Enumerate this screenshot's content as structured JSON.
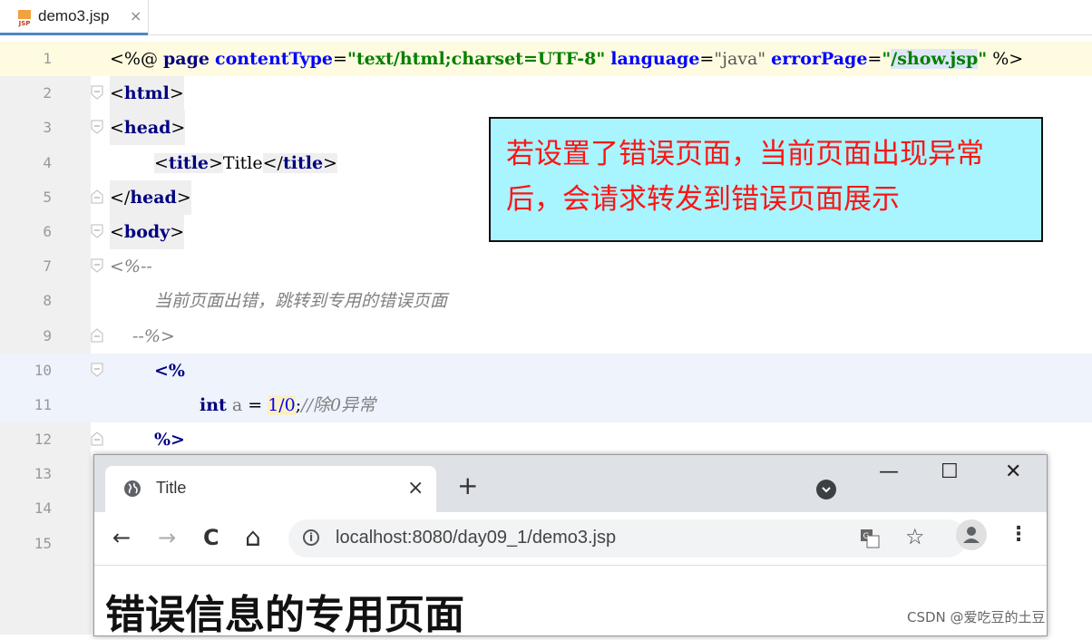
{
  "editor": {
    "tab": {
      "filename": "demo3.jsp",
      "close": "×"
    },
    "line_numbers": [
      "1",
      "2",
      "3",
      "4",
      "5",
      "6",
      "7",
      "8",
      "9",
      "10",
      "11",
      "12",
      "13",
      "14",
      "15"
    ],
    "code": {
      "l1": {
        "open": "<%@ ",
        "page": "page",
        "a1": "contentType",
        "eq1": "=",
        "v1": "\"text/html;charset=UTF-8\"",
        "a2": "language",
        "eq2": "=",
        "v2": "\"java\"",
        "a3": "errorPage",
        "eq3": "=",
        "v3q": "\"",
        "v3": "/show.jsp",
        "v3e": "\"",
        "close": " %>"
      },
      "l2": {
        "lt": "<",
        "tag": "html",
        "gt": ">"
      },
      "l3": {
        "lt": "<",
        "tag": "head",
        "gt": ">"
      },
      "l4": {
        "lt": "<",
        "tag": "title",
        "gt": ">",
        "text": "Title",
        "lt2": "</",
        "tag2": "title",
        "gt2": ">"
      },
      "l5": {
        "lt": "</",
        "tag": "head",
        "gt": ">"
      },
      "l6": {
        "lt": "<",
        "tag": "body",
        "gt": ">"
      },
      "l7": "<%--",
      "l8": "当前页面出错，跳转到专用的错误页面",
      "l9": "--%>",
      "l10": "<%",
      "l11": {
        "kw": "int",
        "ident": "a",
        "eq": " = ",
        "expr": "1/0",
        "semi": ";",
        "comment": "//除0异常"
      },
      "l12": "%>"
    }
  },
  "callout": {
    "text": "若设置了错误页面，当前页面出现异常后，会请求转发到错误页面展示"
  },
  "browser": {
    "tab_title": "Title",
    "tab_close": "×",
    "new_tab": "+",
    "window_controls": {
      "minimize": "—",
      "maximize": "☐",
      "close": "✕"
    },
    "nav": {
      "back": "←",
      "forward": "→",
      "reload": "C",
      "home": "⌂"
    },
    "url": "localhost:8080/day09_1/demo3.jsp",
    "star": "☆",
    "menu": "⋮",
    "page_heading": "错误信息的专用页面"
  },
  "watermark": "CSDN @爱吃豆的土豆",
  "colors": {
    "keyword": "#000080",
    "attribute": "#0000ff",
    "string": "#008000",
    "comment": "#808080",
    "callout_bg": "#a8f4ff",
    "callout_text": "#ff1414"
  }
}
